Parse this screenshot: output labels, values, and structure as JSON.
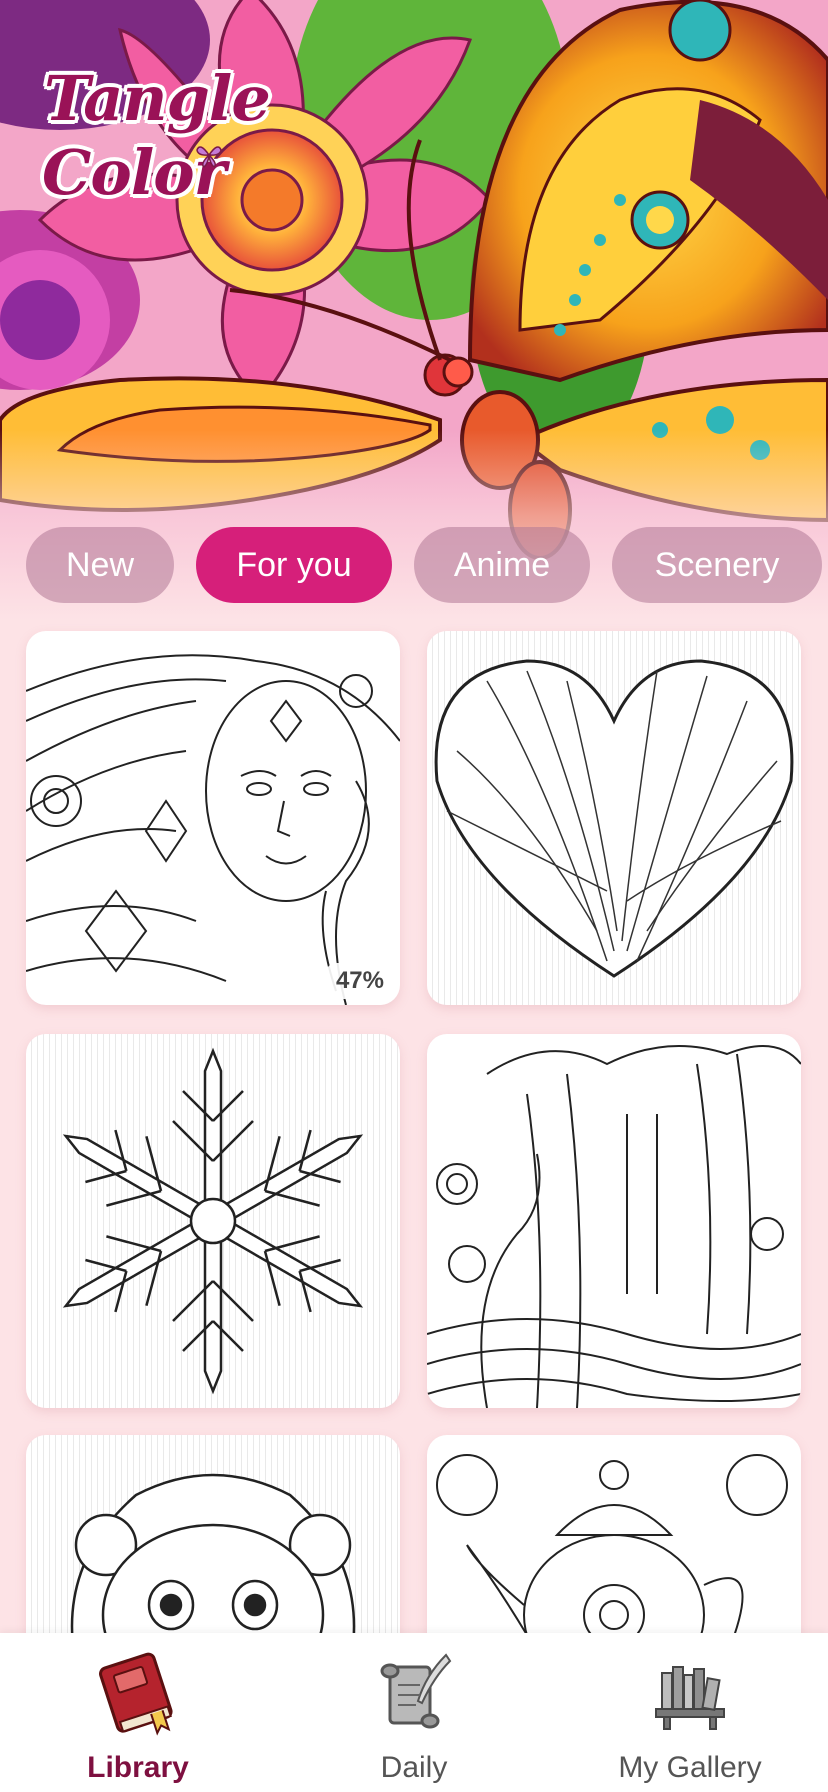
{
  "app": {
    "logo_line1": "Tangle",
    "logo_line2": "Color"
  },
  "categories": [
    {
      "label": "New",
      "active": false
    },
    {
      "label": "For you",
      "active": true
    },
    {
      "label": "Anime",
      "active": false
    },
    {
      "label": "Scenery",
      "active": false
    }
  ],
  "artworks": [
    {
      "subject": "woman-portrait",
      "progress_label": "47%",
      "progress": 47
    },
    {
      "subject": "heart"
    },
    {
      "subject": "snowflake"
    },
    {
      "subject": "forest"
    },
    {
      "subject": "lion-cub"
    },
    {
      "subject": "teapot-set"
    }
  ],
  "bottom_nav": {
    "items": [
      {
        "label": "Library",
        "icon": "book-icon",
        "active": true
      },
      {
        "label": "Daily",
        "icon": "scroll-quill-icon",
        "active": false
      },
      {
        "label": "My Gallery",
        "icon": "bookshelf-icon",
        "active": false
      }
    ]
  },
  "colors": {
    "accent": "#d61f7a",
    "background": "#fde3e6",
    "active_nav": "#7e1040",
    "logo": "#9a1257"
  }
}
